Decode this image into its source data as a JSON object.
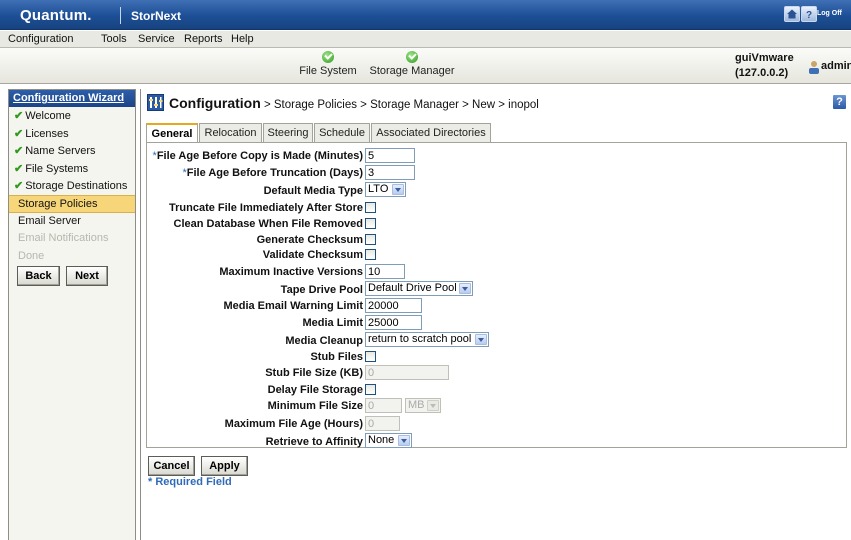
{
  "brand": {
    "logo": "Quantum.",
    "product": "StorNext",
    "logoff": "Log Off"
  },
  "menu": [
    "Configuration",
    "Tools",
    "Service",
    "Reports",
    "Help"
  ],
  "status": {
    "items": [
      "File System",
      "Storage Manager"
    ],
    "user": "guiVmware",
    "ip": "(127.0.0.2)",
    "admin": "admin"
  },
  "sidebar": {
    "title": "Configuration Wizard",
    "items": [
      {
        "label": "Welcome",
        "state": "done"
      },
      {
        "label": "Licenses",
        "state": "done"
      },
      {
        "label": "Name Servers",
        "state": "done"
      },
      {
        "label": "File Systems",
        "state": "done"
      },
      {
        "label": "Storage Destinations",
        "state": "done"
      },
      {
        "label": "Storage Policies",
        "state": "current"
      },
      {
        "label": "Email Server",
        "state": "pending"
      },
      {
        "label": "Email Notifications",
        "state": "disabled"
      },
      {
        "label": "Done",
        "state": "disabled"
      }
    ],
    "back": "Back",
    "next": "Next"
  },
  "header": {
    "root": "Configuration",
    "path": "> Storage Policies > Storage Manager > New > inopol",
    "help": "?"
  },
  "tabs": [
    "General",
    "Relocation",
    "Steering",
    "Schedule",
    "Associated Directories"
  ],
  "form": {
    "file_age_copy": {
      "label": "File Age Before Copy is Made (Minutes)",
      "value": "5"
    },
    "file_age_trunc": {
      "label": "File Age Before Truncation (Days)",
      "value": "3"
    },
    "default_media_type": {
      "label": "Default Media Type",
      "value": "LTO"
    },
    "truncate_after_store": {
      "label": "Truncate File Immediately After Store"
    },
    "clean_db": {
      "label": "Clean Database When File Removed"
    },
    "gen_checksum": {
      "label": "Generate Checksum"
    },
    "validate_checksum": {
      "label": "Validate Checksum"
    },
    "max_inactive": {
      "label": "Maximum Inactive Versions",
      "value": "10"
    },
    "tape_drive_pool": {
      "label": "Tape Drive Pool",
      "value": "Default Drive Pool"
    },
    "media_email_limit": {
      "label": "Media Email Warning Limit",
      "value": "20000"
    },
    "media_limit": {
      "label": "Media Limit",
      "value": "25000"
    },
    "media_cleanup": {
      "label": "Media Cleanup",
      "value": "return to scratch pool"
    },
    "stub_files": {
      "label": "Stub Files"
    },
    "stub_file_size": {
      "label": "Stub File Size (KB)",
      "value": "0"
    },
    "delay_file_storage": {
      "label": "Delay File Storage"
    },
    "min_file_size": {
      "label": "Minimum File Size",
      "value": "0",
      "unit": "MB"
    },
    "max_file_age": {
      "label": "Maximum File Age (Hours)",
      "value": "0"
    },
    "retrieve_affinity": {
      "label": "Retrieve to Affinity",
      "value": "None"
    }
  },
  "actions": {
    "cancel": "Cancel",
    "apply": "Apply",
    "required_note": "* Required Field"
  }
}
